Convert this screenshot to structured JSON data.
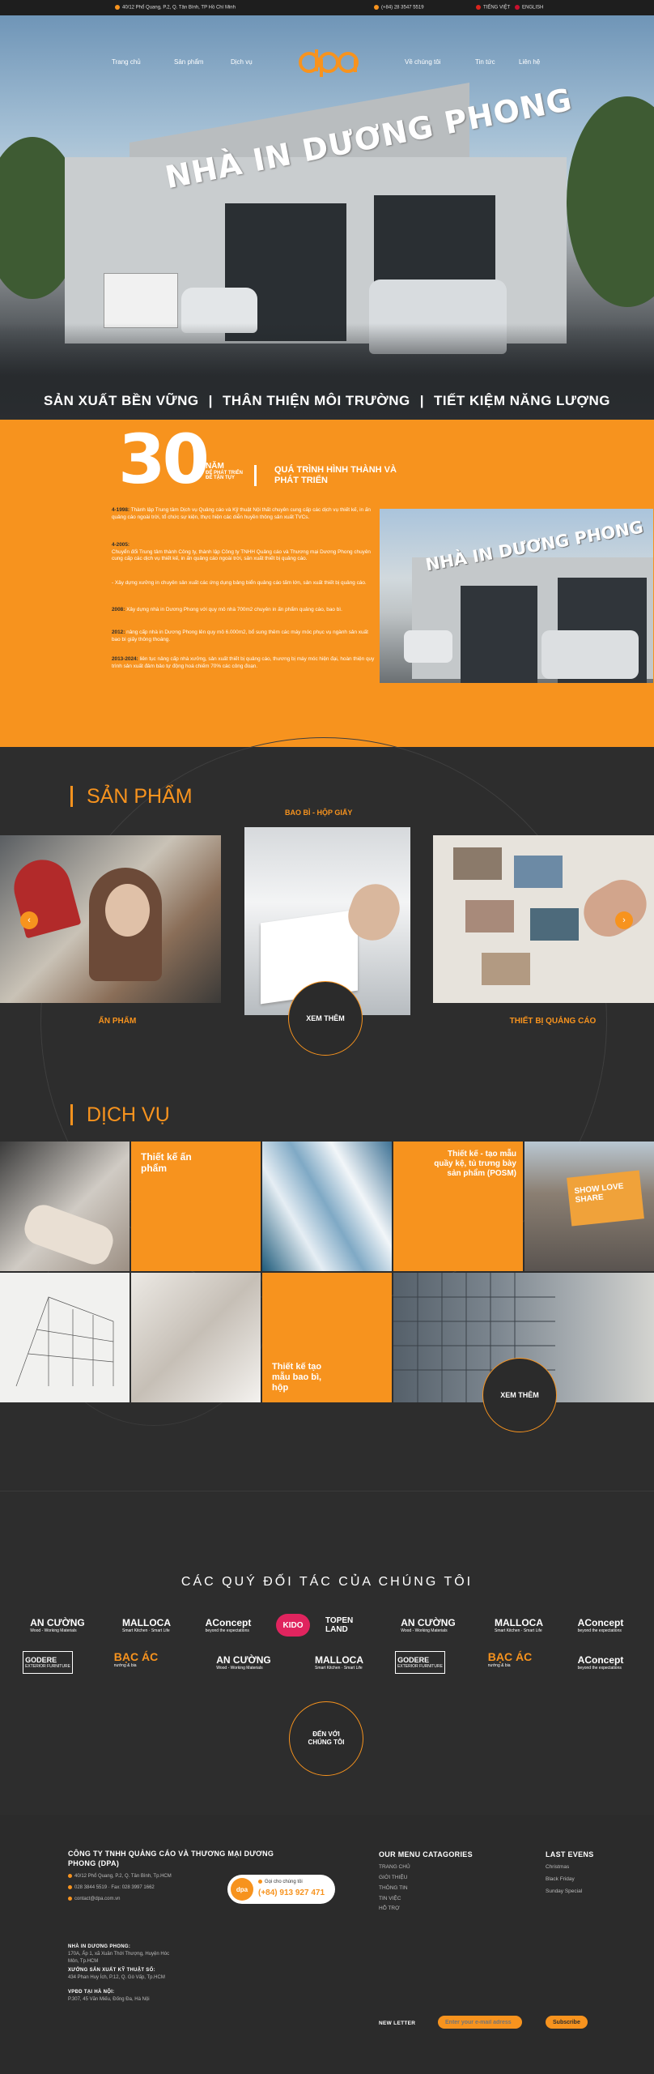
{
  "topbar": {
    "address": "40/12 Phổ Quang, P.2, Q. Tân Bình, TP Hồ Chí Minh",
    "phone": "(+84) 28 3547 5519",
    "lang_vi": "TIẾNG VIỆT",
    "lang_en": "ENGLISH"
  },
  "nav": {
    "home": "Trang chủ",
    "products": "Sản phẩm",
    "services": "Dịch vụ",
    "about": "Về chúng tôi",
    "news": "Tin tức",
    "contact": "Liên hệ",
    "logo_text": "dpa"
  },
  "hero": {
    "sign": "NHÀ IN DƯƠNG PHONG",
    "tag1": "SẢN XUẤT BỀN VỮNG",
    "tag2": "THÂN THIỆN MÔI TRƯỜNG",
    "tag3": "TIẾT KIỆM NĂNG LƯỢNG"
  },
  "history": {
    "big_number": "30",
    "nam": "NĂM",
    "nam_sub": "ĐỂ PHÁT TRIỂN",
    "nam_sub2": "ĐỂ TẬN TỤY",
    "title": "QUÁ TRÌNH HÌNH THÀNH VÀ PHÁT TRIỂN",
    "photo_sign": "NHÀ IN DƯƠNG PHONG",
    "timeline": [
      {
        "year": "4-1998:",
        "text": "Thành lập Trung tâm Dịch vụ Quảng cáo và Kỹ thuật Nội thất chuyên cung cấp các dịch vụ thiết kế, in ấn quảng cáo ngoài trời, tổ chức sự kiện, thực hiện các diễn huyền thông sản xuất TVCs."
      },
      {
        "year": "4-2005:",
        "text": "Chuyển đổi Trung tâm thành Công ty, thành lập Công ty TNHH Quảng cáo và Thương mại Dương Phong chuyên cung cấp các dịch vụ thiết kế, in ấn quảng cáo ngoài trời, sản xuất thiết bị quảng cáo."
      },
      {
        "year": "",
        "text": "- Xây dựng xưởng in chuyên sản xuất các ứng dụng bảng biển quảng cáo tấm lớn, sản xuất thiết bị quảng cáo."
      },
      {
        "year": "2008:",
        "text": "Xây dựng nhà in Dương Phong với quy mô nhà 700m2 chuyên in ấn phẩm quảng cáo, bao bì."
      },
      {
        "year": "2012:",
        "text": "nâng cấp nhà in Dương Phong lên quy mô 6.000m2, bổ sung thêm các máy móc phục vụ ngành sản xuất bao bì giấy thông thoáng."
      },
      {
        "year": "2013-2024:",
        "text": "liên tục nâng cấp nhà xưởng, sản xuất thiết bị quảng cáo, thương bị máy móc hiện đại, hoàn thiện quy trình sản xuất đảm bảo tự động hoá chiếm 70% các công đoạn."
      }
    ]
  },
  "products": {
    "title": "SẢN PHẨM",
    "cat_top": "BAO BÌ - HỘP GIẤY",
    "left_label": "ẤN PHẨM",
    "right_label": "THIẾT BỊ QUẢNG CÁO",
    "btn": "XEM THÊM"
  },
  "services": {
    "title": "DỊCH VỤ",
    "t1": "Thiết kế ấn phẩm",
    "t2": "Thiết kế - tạo mẫu quầy kệ, tủ trưng bày sản phẩm (POSM)",
    "t3": "Thiết kế tạo mẫu bao bì, hộp",
    "btn": "XEM THÊM",
    "billboard": "SHOW LOVE SHARE"
  },
  "partners": {
    "title": "CÁC QUÝ ĐỐI TÁC CỦA CHÚNG TÔI",
    "btn": "ĐẾN VỚI CHÚNG TÔI",
    "logos": [
      {
        "name": "AN CƯỜNG",
        "sub": "Wood - Working Materials"
      },
      {
        "name": "MALLOCA",
        "sub": "Smart Kitchen · Smart Life"
      },
      {
        "name": "AConcept",
        "sub": "beyond the expectations"
      },
      {
        "name": "KIDO"
      },
      {
        "name": "TOPEN LAND"
      },
      {
        "name": "AN CƯỜNG",
        "sub": "Wood - Working Materials"
      },
      {
        "name": "MALLOCA",
        "sub": "Smart Kitchen · Smart Life"
      },
      {
        "name": "AConcept",
        "sub": "beyond the expectations"
      },
      {
        "name": "GODERE",
        "sub": "EXTERIOR FURNITURE"
      },
      {
        "name": "BẠC ÁC",
        "sub": "nướng & bia"
      },
      {
        "name": "AN CƯỜNG",
        "sub": "Wood - Working Materials"
      },
      {
        "name": "MALLOCA",
        "sub": "Smart Kitchen · Smart Life"
      },
      {
        "name": "GODERE",
        "sub": "EXTERIOR FURNITURE"
      },
      {
        "name": "BẠC ÁC",
        "sub": "nướng & bia"
      },
      {
        "name": "AConcept",
        "sub": "beyond the expectations"
      }
    ]
  },
  "footer": {
    "company": "CÔNG TY TNHH QUẢNG CÁO VÀ THƯƠNG MẠI DƯƠNG PHONG (DPA)",
    "address": "40/12 Phổ Quang, P.2, Q. Tân Bình, Tp.HCM",
    "phone": "028 3844 5519 · Fax: 028 3997 1662",
    "email": "contact@dpa.com.vn",
    "call_label": "Gọi cho chúng tôi",
    "hotline": "(+84) 913 927 471",
    "printhouse_title": "NHÀ IN DƯƠNG PHONG:",
    "printhouse_addr": "170A, Ấp 1, xã Xuân Thới Thượng, Huyện Hóc Môn, Tp.HCM",
    "workshop_title": "XƯỞNG SẢN XUẤT KỸ THUẬT SỐ:",
    "workshop_addr": "434 Phan Huy Ích, P.12, Q. Gò Vấp, Tp.HCM",
    "hanoi_title": "VPĐD TẠI HÀ NỘI:",
    "hanoi_addr": "P.307, 45 Văn Miếu, Đống Đa, Hà Nội",
    "menu_title": "OUR MENU CATAGORIES",
    "menu": [
      "TRANG CHỦ",
      "GIỚI THIỆU",
      "THÔNG TIN",
      "TIN VIỆC",
      "HỖ TRỢ"
    ],
    "events_title": "LAST EVENS",
    "events": [
      "Christmas",
      "Black Friday",
      "Sunday Special"
    ],
    "newsletter": "NEW LETTER",
    "email_placeholder": "Enter your e-mail adress",
    "subscribe": "Subscribe"
  },
  "colors": {
    "accent": "#f7931e",
    "dark": "#2d2d2d"
  }
}
